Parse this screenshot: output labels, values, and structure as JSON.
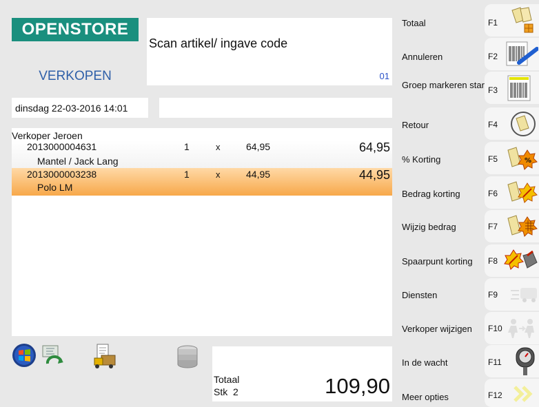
{
  "brand": {
    "logo": "OPENSTORE"
  },
  "section": {
    "title": "VERKOPEN"
  },
  "scan": {
    "prompt": "Scan artikel/ ingave code",
    "code": "01"
  },
  "datetime": "dinsdag 22-03-2016 14:01",
  "receipt": {
    "seller": "Verkoper Jeroen",
    "items": [
      {
        "code": "2013000004631",
        "description": "Mantel / Jack Lang",
        "qty": "1",
        "x": "x",
        "price": "64,95",
        "total": "64,95"
      },
      {
        "code": "2013000003238",
        "description": "Polo LM",
        "qty": "1",
        "x": "x",
        "price": "44,95",
        "total": "44,95"
      }
    ]
  },
  "totals": {
    "label": "Totaal",
    "stk_label": "Stk",
    "stk_value": "2",
    "amount": "109,90"
  },
  "functions": [
    {
      "label": "Totaal",
      "key": "F1",
      "icon": "bags-coins-icon"
    },
    {
      "label": "Annuleren",
      "key": "F2",
      "icon": "barcode-cancel-icon"
    },
    {
      "label": "Groep markeren starten",
      "key": "F3",
      "icon": "barcode-icon"
    },
    {
      "label": "Retour",
      "key": "F4",
      "icon": "return-icon"
    },
    {
      "label": "% Korting",
      "key": "F5",
      "icon": "percent-discount-icon"
    },
    {
      "label": "Bedrag korting",
      "key": "F6",
      "icon": "amount-discount-icon"
    },
    {
      "label": "Wijzig bedrag",
      "key": "F7",
      "icon": "change-amount-icon"
    },
    {
      "label": "Spaarpunt korting",
      "key": "F8",
      "icon": "loyalty-discount-icon"
    },
    {
      "label": "Diensten",
      "key": "F9",
      "icon": "services-icon"
    },
    {
      "label": "Verkoper wijzigen",
      "key": "F10",
      "icon": "change-seller-icon"
    },
    {
      "label": "In de wacht",
      "key": "F11",
      "icon": "parking-meter-icon"
    },
    {
      "label": "Meer opties",
      "key": "F12",
      "icon": "more-options-icon"
    }
  ],
  "bottom_icons": [
    "windows-icon",
    "sync-icon",
    "delivery-icon",
    "database-icon"
  ]
}
